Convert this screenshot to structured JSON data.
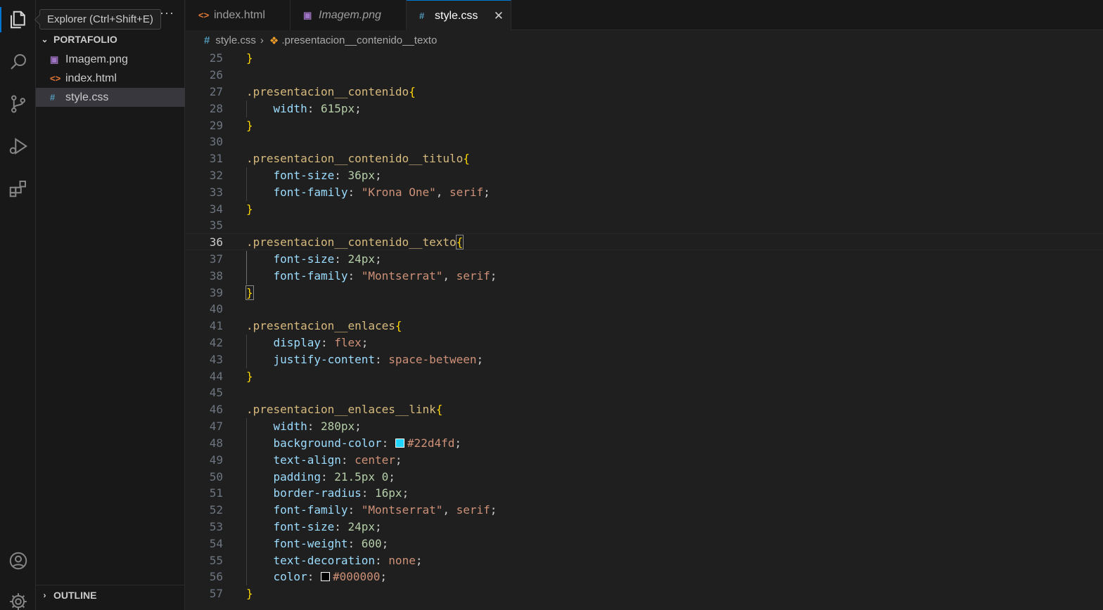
{
  "tooltip": "Explorer (Ctrl+Shift+E)",
  "activity_bar": {
    "items": [
      "explorer-icon",
      "search-icon",
      "source-control-icon",
      "run-debug-icon",
      "extensions-icon",
      "accounts-icon",
      "settings-icon"
    ]
  },
  "sidebar": {
    "more": "···",
    "folder": "PORTAFOLIO",
    "files": [
      {
        "name": "Imagem.png",
        "icon": "image-file-icon"
      },
      {
        "name": "index.html",
        "icon": "html-file-icon"
      },
      {
        "name": "style.css",
        "icon": "css-file-icon",
        "selected": true
      }
    ],
    "outline": "OUTLINE"
  },
  "tabs": [
    {
      "label": "index.html",
      "icon": "html-file-icon"
    },
    {
      "label": "Imagem.png",
      "icon": "image-file-icon"
    },
    {
      "label": "style.css",
      "icon": "css-file-icon",
      "active": true
    }
  ],
  "breadcrumb": {
    "file": "style.css",
    "symbol": ".presentacion__contenido__texto"
  },
  "colors": {
    "accent": "#0078d4",
    "swatch_cyan": "#22d4fd",
    "swatch_black": "#000000"
  },
  "code": {
    "current_line": 36,
    "line_numbers": [
      "25",
      "26",
      "27",
      "28",
      "29",
      "30",
      "31",
      "32",
      "33",
      "34",
      "35",
      "36",
      "37",
      "38",
      "39",
      "40",
      "41",
      "42",
      "43",
      "44",
      "45",
      "46",
      "47",
      "48",
      "49",
      "50",
      "51",
      "52",
      "53",
      "54",
      "55",
      "56",
      "57"
    ],
    "rules": {
      "contenido": {
        "selector": ".presentacion__contenido",
        "props": [
          {
            "name": "width",
            "value": "615px"
          }
        ]
      },
      "titulo": {
        "selector": ".presentacion__contenido__titulo",
        "props": [
          {
            "name": "font-size",
            "value": "36px"
          },
          {
            "name": "font-family",
            "value": "\"Krona One\"",
            "extra": "serif"
          }
        ]
      },
      "texto": {
        "selector": ".presentacion__contenido__texto",
        "props": [
          {
            "name": "font-size",
            "value": "24px"
          },
          {
            "name": "font-family",
            "value": "\"Montserrat\"",
            "extra": "serif"
          }
        ]
      },
      "enlaces": {
        "selector": ".presentacion__enlaces",
        "props": [
          {
            "name": "display",
            "value": "flex"
          },
          {
            "name": "justify-content",
            "value": "space-between"
          }
        ]
      },
      "link": {
        "selector": ".presentacion__enlaces__link",
        "props": [
          {
            "name": "width",
            "value": "280px"
          },
          {
            "name": "background-color",
            "value": "#22d4fd"
          },
          {
            "name": "text-align",
            "value": "center"
          },
          {
            "name": "padding",
            "value": "21.5px 0"
          },
          {
            "name": "border-radius",
            "value": "16px"
          },
          {
            "name": "font-family",
            "value": "\"Montserrat\"",
            "extra": "serif"
          },
          {
            "name": "font-size",
            "value": "24px"
          },
          {
            "name": "font-weight",
            "value": "600"
          },
          {
            "name": "text-decoration",
            "value": "none"
          },
          {
            "name": "color",
            "value": "#000000"
          }
        ]
      }
    }
  }
}
